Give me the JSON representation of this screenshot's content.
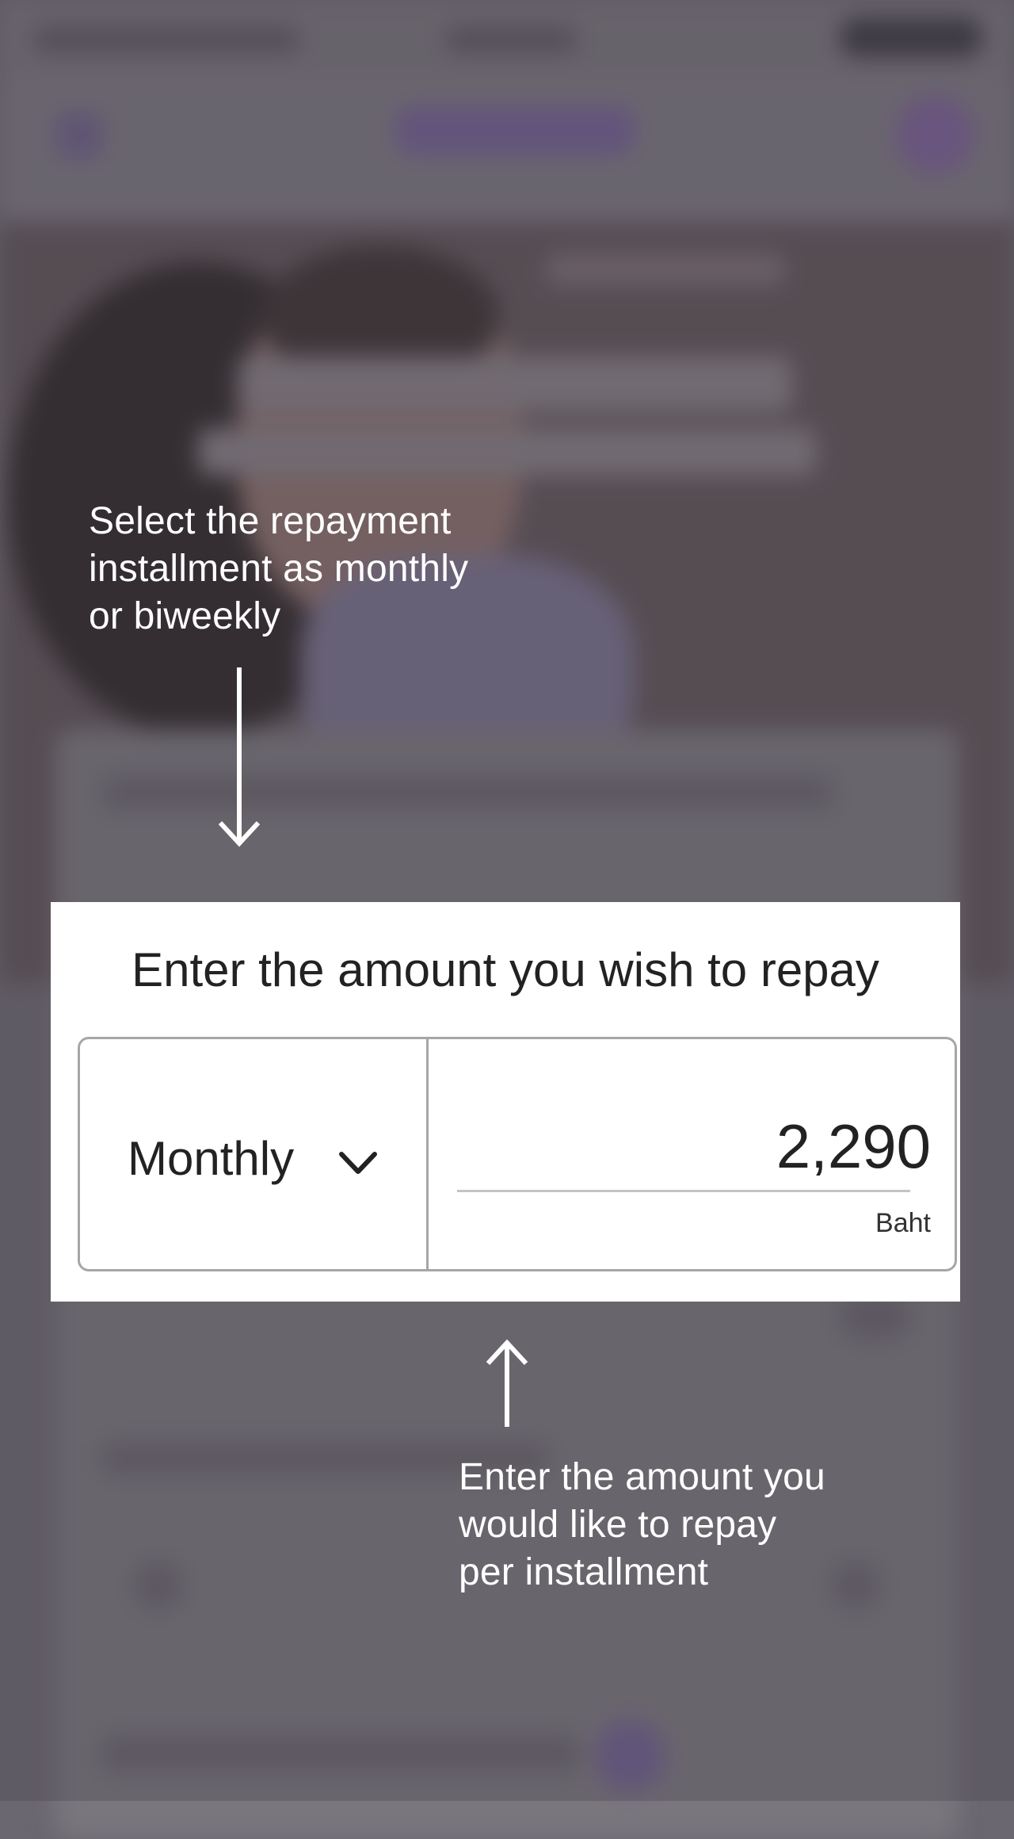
{
  "tooltips": {
    "frequency": {
      "lines": [
        "Select the repayment",
        "installment as monthly",
        "or biweekly"
      ]
    },
    "amount": {
      "lines": [
        "Enter the amount you",
        "would like to repay",
        "per installment"
      ]
    }
  },
  "panel": {
    "title": "Enter the amount you wish to repay",
    "frequency_value": "Monthly",
    "amount_value": "2,290",
    "unit": "Baht"
  },
  "icons": {
    "frequency_dropdown": "chevron-down-icon",
    "tip_arrow_top": "arrow-down-icon",
    "tip_arrow_bottom": "arrow-up-icon"
  },
  "colors": {
    "overlay": "#6b6770",
    "panel_bg": "#ffffff",
    "tooltip_text": "#ffffff",
    "panel_text": "#222222",
    "border": "#a6a6a6"
  }
}
